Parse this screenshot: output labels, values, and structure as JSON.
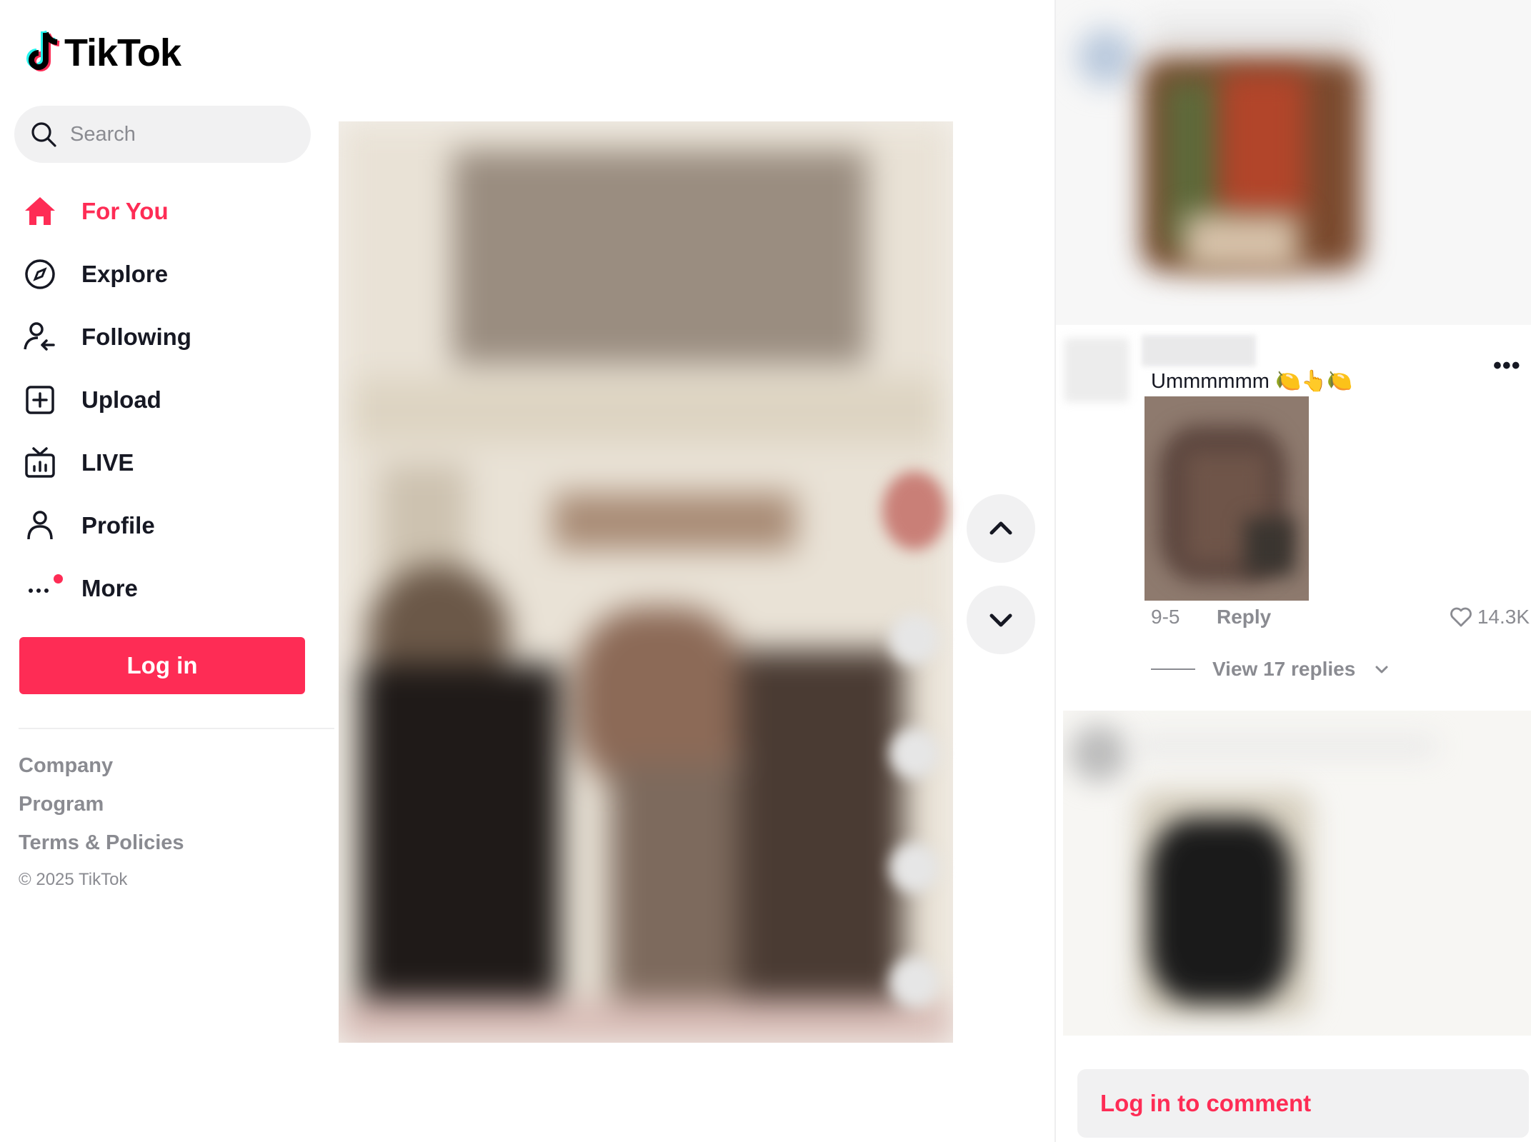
{
  "brand": {
    "name": "TikTok",
    "accent": "#fe2c55",
    "cyan": "#25f4ee"
  },
  "search": {
    "placeholder": "Search",
    "icon": "search-icon"
  },
  "nav": [
    {
      "label": "For You",
      "icon": "home-icon",
      "active": true
    },
    {
      "label": "Explore",
      "icon": "compass-icon",
      "active": false
    },
    {
      "label": "Following",
      "icon": "following-icon",
      "active": false
    },
    {
      "label": "Upload",
      "icon": "plus-square-icon",
      "active": false
    },
    {
      "label": "LIVE",
      "icon": "live-tv-icon",
      "active": false
    },
    {
      "label": "Profile",
      "icon": "person-icon",
      "active": false
    },
    {
      "label": "More",
      "icon": "more-dots-icon",
      "active": false
    }
  ],
  "login_button": "Log in",
  "footer": {
    "links": [
      "Company",
      "Program",
      "Terms & Policies"
    ],
    "copyright": "© 2025 TikTok"
  },
  "video_nav": {
    "up_icon": "chevron-up-icon",
    "down_icon": "chevron-down-icon"
  },
  "comment": {
    "text": "Ummmmmm 🍋👆🍋",
    "date": "9-5",
    "reply_label": "Reply",
    "likes": "14.3K",
    "view_replies": "View 17 replies"
  },
  "comment_login": "Log in to comment"
}
